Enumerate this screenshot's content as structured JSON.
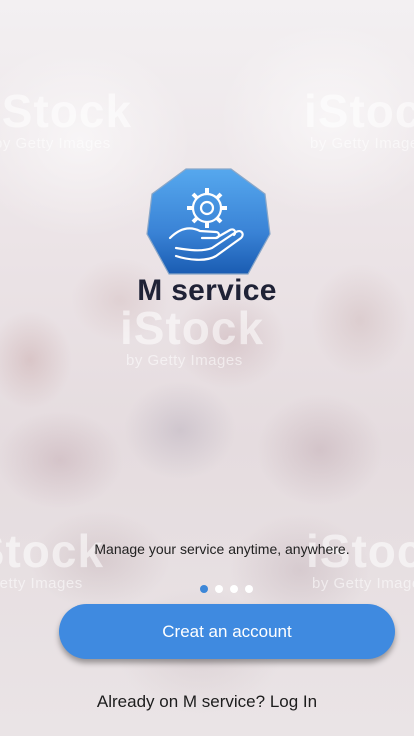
{
  "app": {
    "name": "M service",
    "tagline": "Manage your service anytime, anywhere."
  },
  "logo": {
    "icon": "gear-hand-icon",
    "gradient_top": "#4ba0ea",
    "gradient_bottom": "#1a5fb4"
  },
  "watermark": {
    "brand": "iStock",
    "sub": "by Getty Images"
  },
  "onboarding": {
    "page_count": 4,
    "active_index": 0
  },
  "actions": {
    "create_account_label": "Creat an account",
    "login_prompt": "Already on M service?",
    "login_label": "Log In"
  },
  "colors": {
    "accent": "#3f8ae0",
    "title": "#1f2236"
  }
}
